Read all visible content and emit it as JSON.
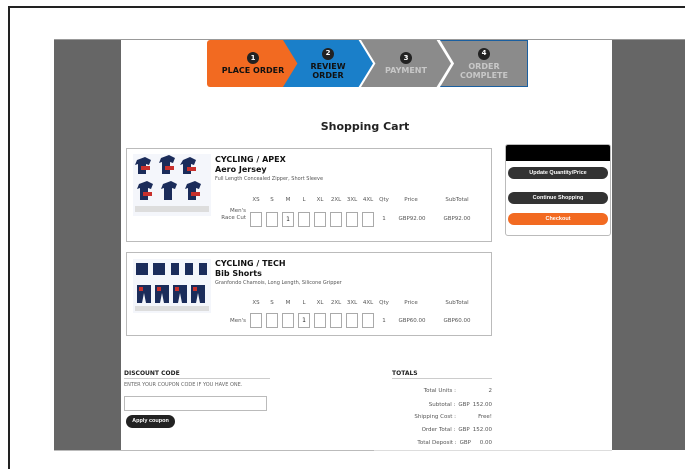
{
  "steps": [
    {
      "num": "1",
      "label": "PLACE ORDER"
    },
    {
      "num": "2",
      "label": "REVIEW ORDER"
    },
    {
      "num": "3",
      "label": "PAYMENT"
    },
    {
      "num": "4",
      "label": "ORDER COMPLETE"
    }
  ],
  "page": {
    "title": "Shopping Cart"
  },
  "size_headers": [
    "XS",
    "S",
    "M",
    "L",
    "XL",
    "2XL",
    "3XL",
    "4XL"
  ],
  "col_headers": {
    "qty": "Qty",
    "price": "Price",
    "subtotal": "SubTotal"
  },
  "items": [
    {
      "category": "CYCLING / APEX",
      "name": "Aero Jersey",
      "description": "Full Length Concealed Zipper, Short Sleeve",
      "fit": "Men's Race Cut",
      "sizes": [
        "",
        "",
        "1",
        "",
        "",
        "",
        "",
        ""
      ],
      "qty": "1",
      "price": "GBP92.00",
      "subtotal": "GBP92.00"
    },
    {
      "category": "CYCLING / TECH",
      "name": "Bib Shorts",
      "description": "Granfondo Chamois, Long Length, Silicone Gripper",
      "fit": "Men's",
      "sizes": [
        "",
        "",
        "",
        "1",
        "",
        "",
        "",
        ""
      ],
      "qty": "1",
      "price": "GBP60.00",
      "subtotal": "GBP60.00"
    }
  ],
  "actions": {
    "update": "Update Quantity/Price",
    "continue": "Continue Shopping",
    "checkout": "Checkout"
  },
  "discount": {
    "title": "DISCOUNT CODE",
    "help": "ENTER YOUR COUPON CODE IF YOU HAVE ONE.",
    "value": "",
    "button": "Apply coupon"
  },
  "totals": {
    "title": "TOTALS",
    "rows": [
      {
        "k": "Total Units :",
        "c": "",
        "v": "2"
      },
      {
        "k": "Subtotal :",
        "c": "GBP",
        "v": "152.00"
      },
      {
        "k": "Shipping Cost :",
        "c": "",
        "v": "Free!"
      },
      {
        "k": "Order Total :",
        "c": "GBP",
        "v": "152.00"
      },
      {
        "k": "Total Deposit :",
        "c": "GBP",
        "v": "0.00"
      }
    ]
  },
  "colors": {
    "accent": "#f26a21",
    "active_step": "#1a7fc9",
    "inactive_step": "#8b8b8b"
  }
}
